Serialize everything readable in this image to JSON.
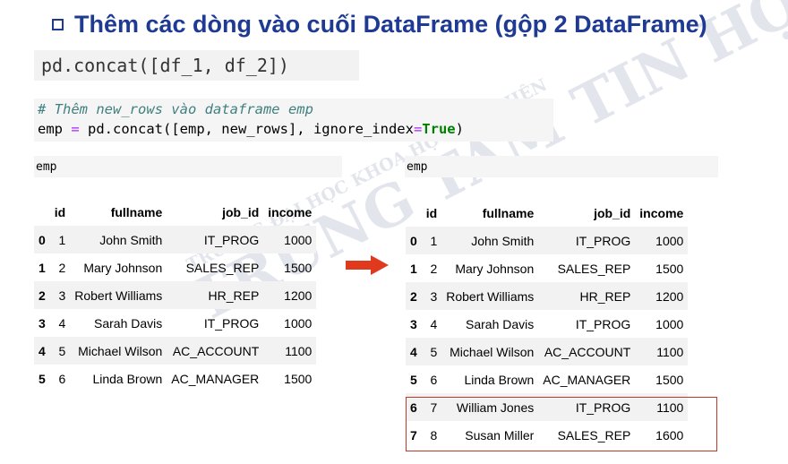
{
  "title": "Thêm các dòng vào cuối DataFrame (gộp 2 DataFrame)",
  "syntax": "pd.concat([df_1, df_2])",
  "code": {
    "comment": "# Thêm new_rows vào dataframe emp",
    "line_a": "emp ",
    "line_eq": "=",
    "line_b": " pd.concat([emp, new_rows], ignore_index",
    "line_eq2": "=",
    "line_true": "True",
    "line_c": ")"
  },
  "left_label": "emp",
  "right_label": "emp",
  "columns": [
    "",
    "id",
    "fullname",
    "job_id",
    "income"
  ],
  "left_rows": [
    [
      "0",
      "1",
      "John Smith",
      "IT_PROG",
      "1000"
    ],
    [
      "1",
      "2",
      "Mary Johnson",
      "SALES_REP",
      "1500"
    ],
    [
      "2",
      "3",
      "Robert Williams",
      "HR_REP",
      "1200"
    ],
    [
      "3",
      "4",
      "Sarah Davis",
      "IT_PROG",
      "1000"
    ],
    [
      "4",
      "5",
      "Michael Wilson",
      "AC_ACCOUNT",
      "1100"
    ],
    [
      "5",
      "6",
      "Linda Brown",
      "AC_MANAGER",
      "1500"
    ]
  ],
  "right_rows": [
    [
      "0",
      "1",
      "John Smith",
      "IT_PROG",
      "1000"
    ],
    [
      "1",
      "2",
      "Mary Johnson",
      "SALES_REP",
      "1500"
    ],
    [
      "2",
      "3",
      "Robert Williams",
      "HR_REP",
      "1200"
    ],
    [
      "3",
      "4",
      "Sarah Davis",
      "IT_PROG",
      "1000"
    ],
    [
      "4",
      "5",
      "Michael Wilson",
      "AC_ACCOUNT",
      "1100"
    ],
    [
      "5",
      "6",
      "Linda Brown",
      "AC_MANAGER",
      "1500"
    ],
    [
      "6",
      "7",
      "William Jones",
      "IT_PROG",
      "1100"
    ],
    [
      "7",
      "8",
      "Susan Miller",
      "SALES_REP",
      "1600"
    ]
  ],
  "watermark": {
    "line1": "TRUNG TÂM TIN HỌC",
    "line2": "TRƯỜNG ĐẠI HỌC KHOA HỌC TỰ NHIÊN"
  },
  "colors": {
    "title": "#1f3a93",
    "arrow": "#e03a1e",
    "highlight": "#c0392b"
  }
}
